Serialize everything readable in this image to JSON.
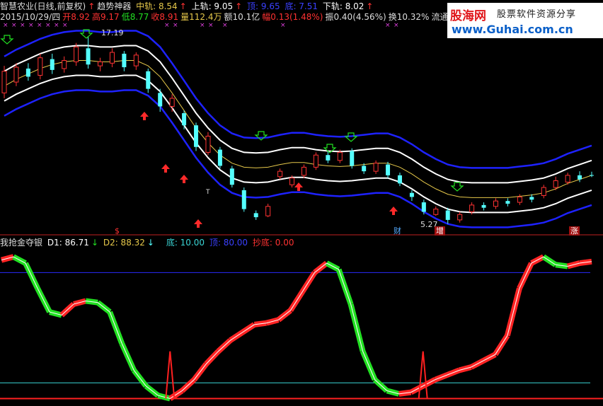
{
  "header": {
    "row1": {
      "stock": "智慧农业(日线,前复权)",
      "up_arrow": "↑",
      "indicator": "趋势神器",
      "mid": "中轨: 8.54",
      "upper": "上轨: 9.05",
      "top": "顶: 9.65",
      "bottom": "底: 7.51",
      "lower": "下轨: 8.02"
    },
    "row2": {
      "date": "2015/10/29/四",
      "open": "开8.92",
      "high": "高9.17",
      "low": "低8.77",
      "close": "收8.91",
      "vol": "量112.4万",
      "amount": "额10.1亿",
      "range": "幅0.13(1.48%)",
      "amp": "振0.40(4.56%)",
      "turnover": "换10.32%",
      "float": "流通10.9亿"
    },
    "sub": {
      "name": "我抢金夺银",
      "d1": "D1: 86.71",
      "d2": "D2: 88.32",
      "di": "底: 10.00",
      "ding": "顶: 80.00",
      "chaodi": "抄底: 0.00"
    }
  },
  "logo": {
    "site": "股海网",
    "slogan": "股票软件资源分享",
    "url": "www.Guhai.com.cn"
  },
  "annotations": {
    "high_label": "17.19",
    "low_label": "5.27",
    "badge_cai": "财",
    "badge_zeng": "增",
    "badge_end": "涨",
    "dollar": "$",
    "small_t": "T"
  },
  "colors": {
    "up": "#ff3232",
    "down": "#54ffff",
    "band_outer": "#1e22ff",
    "band_inner": "#ffffff",
    "mid": "#e6c84a",
    "line_d": "#ff2020",
    "fill_green": "#22e022",
    "fill_red": "#ff2424",
    "ref_top": "#2a2aff",
    "ref_bottom": "#3ad6d6"
  },
  "chart_data": [
    {
      "type": "candlestick",
      "series": [
        {
          "name": "中轨",
          "values": [
            15.5,
            16.0,
            16.4,
            16.8,
            17.1,
            17.3,
            17.4,
            17.4,
            17.3,
            17.3,
            17.4,
            17.4,
            17.0,
            16.2,
            15.0,
            13.7,
            12.4,
            11.3,
            10.4,
            9.8,
            9.5,
            9.45,
            9.5,
            9.7,
            9.85,
            9.85,
            9.7,
            9.6,
            9.55,
            9.6,
            9.7,
            9.8,
            9.8,
            9.5,
            9.0,
            8.4,
            7.9,
            7.5,
            7.3,
            7.25,
            7.25,
            7.25,
            7.25,
            7.35,
            7.45,
            7.6,
            7.9,
            8.3,
            8.6,
            8.9
          ]
        },
        {
          "name": "上轨"
        },
        {
          "name": "下轨"
        }
      ],
      "candles": [
        {
          "o": 15.0,
          "c": 16.6,
          "h": 17.0,
          "l": 14.6
        },
        {
          "o": 15.8,
          "c": 16.9,
          "h": 17.2,
          "l": 15.5
        },
        {
          "o": 16.8,
          "c": 16.2,
          "h": 17.2,
          "l": 15.9
        },
        {
          "o": 16.3,
          "c": 17.6,
          "h": 17.9,
          "l": 16.0
        },
        {
          "o": 17.5,
          "c": 16.7,
          "h": 17.9,
          "l": 16.4
        },
        {
          "o": 16.8,
          "c": 17.4,
          "h": 17.7,
          "l": 16.5
        },
        {
          "o": 17.3,
          "c": 18.4,
          "h": 18.7,
          "l": 17.0
        },
        {
          "o": 18.3,
          "c": 17.1,
          "h": 19.2,
          "l": 16.8
        },
        {
          "o": 17.0,
          "c": 17.3,
          "h": 17.6,
          "l": 16.6
        },
        {
          "o": 17.2,
          "c": 18.0,
          "h": 18.3,
          "l": 16.9
        },
        {
          "o": 17.9,
          "c": 16.9,
          "h": 18.1,
          "l": 16.6
        },
        {
          "o": 17.0,
          "c": 17.8,
          "h": 18.0,
          "l": 16.7
        },
        {
          "o": 16.6,
          "c": 15.3,
          "h": 16.8,
          "l": 15.0
        },
        {
          "o": 15.0,
          "c": 14.0,
          "h": 15.3,
          "l": 13.6
        },
        {
          "o": 14.0,
          "c": 14.6,
          "h": 14.9,
          "l": 13.6
        },
        {
          "o": 13.5,
          "c": 12.6,
          "h": 13.7,
          "l": 12.3
        },
        {
          "o": 12.6,
          "c": 11.0,
          "h": 12.8,
          "l": 10.7
        },
        {
          "o": 10.6,
          "c": 11.8,
          "h": 12.1,
          "l": 10.4
        },
        {
          "o": 10.8,
          "c": 9.6,
          "h": 11.0,
          "l": 9.4
        },
        {
          "o": 9.4,
          "c": 8.2,
          "h": 9.6,
          "l": 8.0
        },
        {
          "o": 7.8,
          "c": 6.4,
          "h": 8.0,
          "l": 6.2
        },
        {
          "o": 6.1,
          "c": 5.8,
          "h": 6.3,
          "l": 5.6
        },
        {
          "o": 5.9,
          "c": 6.6,
          "h": 6.8,
          "l": 5.8
        },
        {
          "o": 8.8,
          "c": 9.2,
          "h": 9.4,
          "l": 8.6
        },
        {
          "o": 8.2,
          "c": 8.7,
          "h": 8.9,
          "l": 8.0
        },
        {
          "o": 8.9,
          "c": 9.5,
          "h": 9.7,
          "l": 8.7
        },
        {
          "o": 9.5,
          "c": 10.4,
          "h": 10.6,
          "l": 9.3
        },
        {
          "o": 10.4,
          "c": 10.0,
          "h": 10.7,
          "l": 9.8
        },
        {
          "o": 10.0,
          "c": 10.6,
          "h": 10.8,
          "l": 9.8
        },
        {
          "o": 10.7,
          "c": 9.6,
          "h": 10.9,
          "l": 9.4
        },
        {
          "o": 9.6,
          "c": 9.2,
          "h": 9.8,
          "l": 9.0
        },
        {
          "o": 9.2,
          "c": 9.8,
          "h": 10.0,
          "l": 9.0
        },
        {
          "o": 9.7,
          "c": 8.9,
          "h": 9.9,
          "l": 8.7
        },
        {
          "o": 8.9,
          "c": 8.3,
          "h": 9.1,
          "l": 8.1
        },
        {
          "o": 7.6,
          "c": 7.3,
          "h": 7.8,
          "l": 7.0
        },
        {
          "o": 6.9,
          "c": 6.2,
          "h": 7.1,
          "l": 6.0
        },
        {
          "o": 6.0,
          "c": 6.4,
          "h": 6.6,
          "l": 5.9
        },
        {
          "o": 6.3,
          "c": 5.6,
          "h": 6.5,
          "l": 5.3
        },
        {
          "o": 5.6,
          "c": 6.0,
          "h": 6.2,
          "l": 5.4
        },
        {
          "o": 6.2,
          "c": 6.7,
          "h": 6.9,
          "l": 6.0
        },
        {
          "o": 6.7,
          "c": 6.5,
          "h": 6.9,
          "l": 6.3
        },
        {
          "o": 6.6,
          "c": 7.0,
          "h": 7.2,
          "l": 6.4
        },
        {
          "o": 7.0,
          "c": 6.8,
          "h": 7.2,
          "l": 6.6
        },
        {
          "o": 6.9,
          "c": 7.3,
          "h": 7.5,
          "l": 6.7
        },
        {
          "o": 7.3,
          "c": 7.1,
          "h": 7.5,
          "l": 6.9
        },
        {
          "o": 7.4,
          "c": 8.0,
          "h": 8.2,
          "l": 7.2
        },
        {
          "o": 8.0,
          "c": 8.5,
          "h": 8.8,
          "l": 7.8
        },
        {
          "o": 8.4,
          "c": 8.9,
          "h": 9.1,
          "l": 8.2
        },
        {
          "o": 8.9,
          "c": 8.6,
          "h": 9.2,
          "l": 8.4
        },
        {
          "o": 8.92,
          "c": 8.91,
          "h": 9.17,
          "l": 8.77
        }
      ],
      "ylim": [
        4.6,
        20.2
      ]
    },
    {
      "type": "line",
      "series": [
        {
          "name": "D1",
          "values": [
            88,
            90,
            86,
            70,
            55,
            53,
            60,
            62,
            61,
            55,
            35,
            18,
            8,
            2,
            0,
            5,
            12,
            22,
            30,
            37,
            42,
            47,
            48,
            50,
            56,
            68,
            80,
            86,
            82,
            60,
            30,
            12,
            5,
            3,
            4,
            8,
            12,
            15,
            18,
            20,
            24,
            28,
            40,
            70,
            86,
            90,
            85,
            84,
            86,
            87
          ]
        }
      ],
      "reference_lines": [
        80,
        10
      ],
      "ylim": [
        -2,
        95
      ]
    }
  ]
}
